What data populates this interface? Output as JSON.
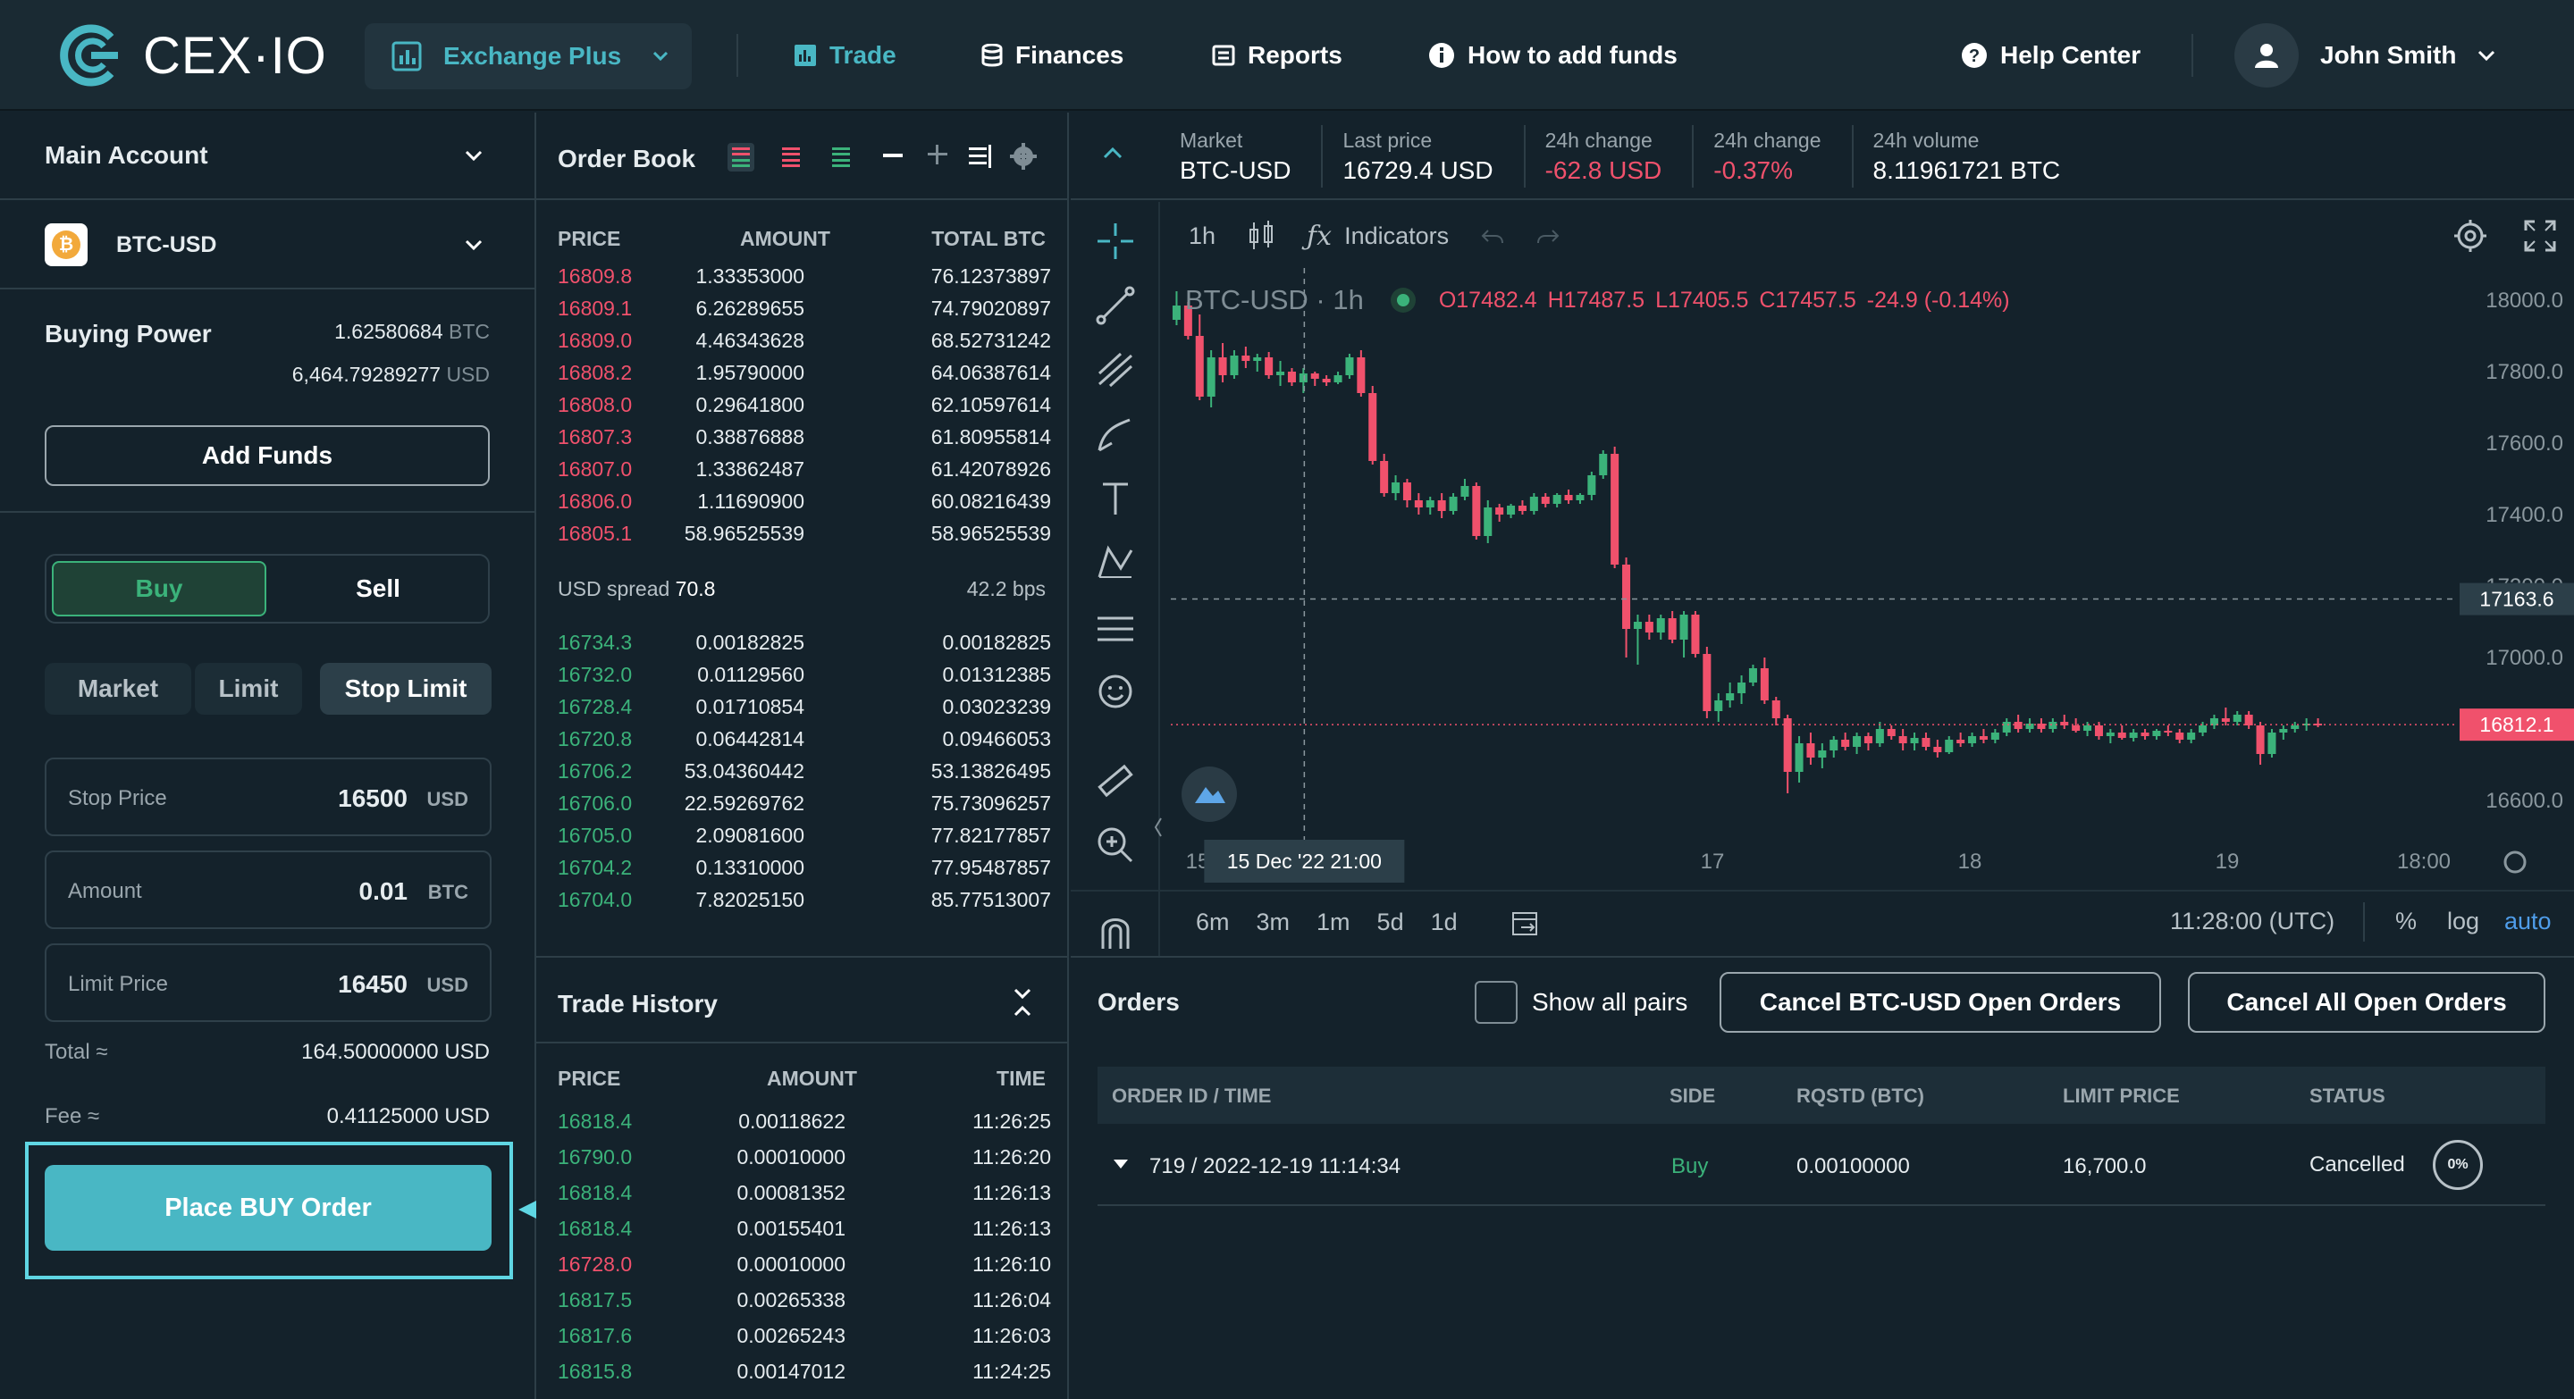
{
  "header": {
    "logo_text": "CEX·IO",
    "product_dropdown": "Exchange Plus",
    "nav": [
      {
        "label": "Trade"
      },
      {
        "label": "Finances"
      },
      {
        "label": "Reports"
      },
      {
        "label": "How to add funds"
      }
    ],
    "help_center": "Help Center",
    "user_name": "John Smith"
  },
  "left": {
    "account": "Main Account",
    "pair": "BTC-USD",
    "buying_power_label": "Buying Power",
    "bp_btc_value": "1.62580684",
    "bp_btc_unit": "BTC",
    "bp_usd_value": "6,464.79289277",
    "bp_usd_unit": "USD",
    "add_funds": "Add Funds",
    "buy": "Buy",
    "sell": "Sell",
    "order_types": [
      "Market",
      "Limit",
      "Stop Limit"
    ],
    "stop_price": {
      "label": "Stop Price",
      "value": "16500",
      "unit": "USD"
    },
    "amount": {
      "label": "Amount",
      "value": "0.01",
      "unit": "BTC"
    },
    "limit_price": {
      "label": "Limit Price",
      "value": "16450",
      "unit": "USD"
    },
    "total_label": "Total ≈",
    "total_value": "164.50000000 USD",
    "fee_label": "Fee ≈",
    "fee_value": "0.41125000 USD",
    "place_order": "Place BUY Order"
  },
  "orderbook": {
    "title": "Order Book",
    "columns": [
      "PRICE",
      "AMOUNT",
      "TOTAL BTC"
    ],
    "asks": [
      [
        "16809.8",
        "1.33353000",
        "76.12373897"
      ],
      [
        "16809.1",
        "6.26289655",
        "74.79020897"
      ],
      [
        "16809.0",
        "4.46343628",
        "68.52731242"
      ],
      [
        "16808.2",
        "1.95790000",
        "64.06387614"
      ],
      [
        "16808.0",
        "0.29641800",
        "62.10597614"
      ],
      [
        "16807.3",
        "0.38876888",
        "61.80955814"
      ],
      [
        "16807.0",
        "1.33862487",
        "61.42078926"
      ],
      [
        "16806.0",
        "1.11690900",
        "60.08216439"
      ],
      [
        "16805.1",
        "58.96525539",
        "58.96525539"
      ]
    ],
    "spread_label": "USD spread",
    "spread_value": "70.8",
    "spread_bps": "42.2 bps",
    "bids": [
      [
        "16734.3",
        "0.00182825",
        "0.00182825"
      ],
      [
        "16732.0",
        "0.01129560",
        "0.01312385"
      ],
      [
        "16728.4",
        "0.01710854",
        "0.03023239"
      ],
      [
        "16720.8",
        "0.06442814",
        "0.09466053"
      ],
      [
        "16706.2",
        "53.04360442",
        "53.13826495"
      ],
      [
        "16706.0",
        "22.59269762",
        "75.73096257"
      ],
      [
        "16705.0",
        "2.09081600",
        "77.82177857"
      ],
      [
        "16704.2",
        "0.13310000",
        "77.95487857"
      ],
      [
        "16704.0",
        "7.82025150",
        "85.77513007"
      ]
    ]
  },
  "trade_history": {
    "title": "Trade History",
    "columns": [
      "PRICE",
      "AMOUNT",
      "TIME"
    ],
    "rows": [
      {
        "price": "16818.4",
        "amount": "0.00118622",
        "time": "11:26:25",
        "side": "buy"
      },
      {
        "price": "16790.0",
        "amount": "0.00010000",
        "time": "11:26:20",
        "side": "buy"
      },
      {
        "price": "16818.4",
        "amount": "0.00081352",
        "time": "11:26:13",
        "side": "buy"
      },
      {
        "price": "16818.4",
        "amount": "0.00155401",
        "time": "11:26:13",
        "side": "buy"
      },
      {
        "price": "16728.0",
        "amount": "0.00010000",
        "time": "11:26:10",
        "side": "sell"
      },
      {
        "price": "16817.5",
        "amount": "0.00265338",
        "time": "11:26:04",
        "side": "buy"
      },
      {
        "price": "16817.6",
        "amount": "0.00265243",
        "time": "11:26:03",
        "side": "buy"
      },
      {
        "price": "16815.8",
        "amount": "0.00147012",
        "time": "11:24:25",
        "side": "buy"
      }
    ]
  },
  "market_stats": [
    {
      "label": "Market",
      "value": "BTC-USD",
      "color": "#ffffff"
    },
    {
      "label": "Last price",
      "value": "16729.4 USD",
      "color": "#ffffff"
    },
    {
      "label": "24h change",
      "value": "-62.8 USD",
      "color": "#f0516c"
    },
    {
      "label": "24h change",
      "value": "-0.37%",
      "color": "#f0516c"
    },
    {
      "label": "24h volume",
      "value": "8.11961721 BTC",
      "color": "#ffffff"
    }
  ],
  "chart_toolbar": {
    "interval": "1h",
    "indicators": "Indicators"
  },
  "chart_legend": {
    "symbol": "BTC-USD · 1h",
    "o": "O17482.4",
    "h": "H17487.5",
    "l": "L17405.5",
    "c": "C17457.5",
    "chg": "-24.9 (-0.14%)"
  },
  "chart_bottom": {
    "ranges": [
      "6m",
      "3m",
      "1m",
      "5d",
      "1d"
    ],
    "clock": "11:28:00 (UTC)",
    "pct": "%",
    "log": "log",
    "auto": "auto"
  },
  "chart_data": {
    "type": "candlestick",
    "title": "BTC-USD · 1h",
    "yticks": [
      "18000.0",
      "17800.0",
      "17600.0",
      "17400.0",
      "17200.0",
      "17000.0",
      "16800.0",
      "16600.0"
    ],
    "xticks": [
      "15",
      "17",
      "18",
      "19",
      "18:00"
    ],
    "crosshair_x_label": "15 Dec '22  21:00",
    "crosshair_price": "17163.6",
    "last_price_label": "16812.1",
    "ylim": [
      16470,
      18090
    ],
    "candles": [
      [
        17945,
        18025,
        17930,
        17985
      ],
      [
        17985,
        17995,
        17890,
        17900
      ],
      [
        17900,
        17960,
        17720,
        17730
      ],
      [
        17730,
        17860,
        17700,
        17840
      ],
      [
        17840,
        17880,
        17770,
        17790
      ],
      [
        17790,
        17860,
        17780,
        17845
      ],
      [
        17845,
        17870,
        17810,
        17830
      ],
      [
        17830,
        17850,
        17800,
        17840
      ],
      [
        17840,
        17855,
        17780,
        17790
      ],
      [
        17790,
        17830,
        17760,
        17800
      ],
      [
        17800,
        17810,
        17760,
        17770
      ],
      [
        17770,
        17810,
        17740,
        17795
      ],
      [
        17795,
        17800,
        17760,
        17780
      ],
      [
        17780,
        17790,
        17760,
        17770
      ],
      [
        17770,
        17800,
        17765,
        17790
      ],
      [
        17790,
        17850,
        17780,
        17840
      ],
      [
        17840,
        17860,
        17730,
        17740
      ],
      [
        17740,
        17760,
        17540,
        17550
      ],
      [
        17550,
        17570,
        17450,
        17460
      ],
      [
        17460,
        17510,
        17440,
        17490
      ],
      [
        17490,
        17500,
        17420,
        17440
      ],
      [
        17440,
        17460,
        17400,
        17420
      ],
      [
        17420,
        17450,
        17400,
        17440
      ],
      [
        17440,
        17460,
        17390,
        17410
      ],
      [
        17410,
        17460,
        17400,
        17450
      ],
      [
        17450,
        17500,
        17440,
        17480
      ],
      [
        17480,
        17490,
        17330,
        17340
      ],
      [
        17340,
        17440,
        17320,
        17420
      ],
      [
        17420,
        17430,
        17380,
        17400
      ],
      [
        17400,
        17430,
        17390,
        17425
      ],
      [
        17425,
        17440,
        17400,
        17410
      ],
      [
        17410,
        17460,
        17400,
        17450
      ],
      [
        17450,
        17460,
        17420,
        17430
      ],
      [
        17430,
        17460,
        17420,
        17455
      ],
      [
        17455,
        17470,
        17430,
        17440
      ],
      [
        17440,
        17460,
        17430,
        17455
      ],
      [
        17455,
        17520,
        17440,
        17510
      ],
      [
        17510,
        17580,
        17500,
        17570
      ],
      [
        17570,
        17590,
        17250,
        17260
      ],
      [
        17260,
        17280,
        17000,
        17080
      ],
      [
        17080,
        17120,
        16980,
        17100
      ],
      [
        17100,
        17120,
        17050,
        17070
      ],
      [
        17070,
        17120,
        17050,
        17110
      ],
      [
        17110,
        17130,
        17040,
        17050
      ],
      [
        17050,
        17130,
        17000,
        17120
      ],
      [
        17120,
        17130,
        17000,
        17010
      ],
      [
        17010,
        17030,
        16830,
        16850
      ],
      [
        16850,
        16900,
        16820,
        16880
      ],
      [
        16880,
        16930,
        16860,
        16900
      ],
      [
        16900,
        16950,
        16870,
        16930
      ],
      [
        16930,
        16980,
        16920,
        16970
      ],
      [
        16970,
        17000,
        16870,
        16880
      ],
      [
        16880,
        16890,
        16810,
        16830
      ],
      [
        16830,
        16840,
        16620,
        16680
      ],
      [
        16680,
        16780,
        16650,
        16760
      ],
      [
        16760,
        16790,
        16700,
        16720
      ],
      [
        16720,
        16760,
        16690,
        16740
      ],
      [
        16740,
        16780,
        16720,
        16770
      ],
      [
        16770,
        16790,
        16740,
        16750
      ],
      [
        16750,
        16790,
        16730,
        16780
      ],
      [
        16780,
        16790,
        16740,
        16760
      ],
      [
        16760,
        16820,
        16750,
        16800
      ],
      [
        16800,
        16810,
        16770,
        16780
      ],
      [
        16780,
        16800,
        16740,
        16760
      ],
      [
        16760,
        16790,
        16740,
        16775
      ],
      [
        16775,
        16790,
        16740,
        16750
      ],
      [
        16750,
        16770,
        16720,
        16735
      ],
      [
        16735,
        16780,
        16730,
        16770
      ],
      [
        16770,
        16790,
        16750,
        16760
      ],
      [
        16760,
        16790,
        16750,
        16780
      ],
      [
        16780,
        16800,
        16760,
        16770
      ],
      [
        16770,
        16800,
        16760,
        16790
      ],
      [
        16790,
        16830,
        16780,
        16820
      ],
      [
        16820,
        16840,
        16790,
        16800
      ],
      [
        16800,
        16830,
        16790,
        16815
      ],
      [
        16815,
        16830,
        16790,
        16800
      ],
      [
        16800,
        16830,
        16790,
        16820
      ],
      [
        16820,
        16840,
        16800,
        16810
      ],
      [
        16810,
        16830,
        16790,
        16795
      ],
      [
        16795,
        16820,
        16780,
        16810
      ],
      [
        16810,
        16820,
        16770,
        16780
      ],
      [
        16780,
        16800,
        16760,
        16790
      ],
      [
        16790,
        16810,
        16770,
        16775
      ],
      [
        16775,
        16800,
        16765,
        16790
      ],
      [
        16790,
        16800,
        16770,
        16780
      ],
      [
        16780,
        16800,
        16770,
        16795
      ],
      [
        16795,
        16810,
        16780,
        16790
      ],
      [
        16790,
        16800,
        16760,
        16770
      ],
      [
        16770,
        16800,
        16760,
        16790
      ],
      [
        16790,
        16820,
        16780,
        16810
      ],
      [
        16810,
        16840,
        16800,
        16830
      ],
      [
        16830,
        16860,
        16810,
        16820
      ],
      [
        16820,
        16850,
        16810,
        16840
      ],
      [
        16840,
        16850,
        16800,
        16810
      ],
      [
        16810,
        16820,
        16700,
        16730
      ],
      [
        16730,
        16800,
        16720,
        16790
      ],
      [
        16790,
        16810,
        16770,
        16800
      ],
      [
        16800,
        16820,
        16790,
        16810
      ],
      [
        16810,
        16830,
        16795,
        16815
      ],
      [
        16815,
        16830,
        16805,
        16812
      ]
    ]
  },
  "orders": {
    "title": "Orders",
    "show_all_pairs": "Show all pairs",
    "cancel_pair": "Cancel BTC-USD Open Orders",
    "cancel_all": "Cancel All Open Orders",
    "columns": [
      "ORDER ID / TIME",
      "SIDE",
      "RQSTD (BTC)",
      "LIMIT PRICE",
      "STATUS"
    ],
    "rows": [
      {
        "id_time": "719 / 2022-12-19 11:14:34",
        "side": "Buy",
        "rqstd": "0.00100000",
        "limit_price": "16,700.0",
        "status": "Cancelled",
        "progress": "0%"
      }
    ]
  },
  "colors": {
    "accent": "#49b7c4",
    "up": "#3bb27a",
    "down": "#f0516c",
    "highlight": "#5fd6e3"
  }
}
